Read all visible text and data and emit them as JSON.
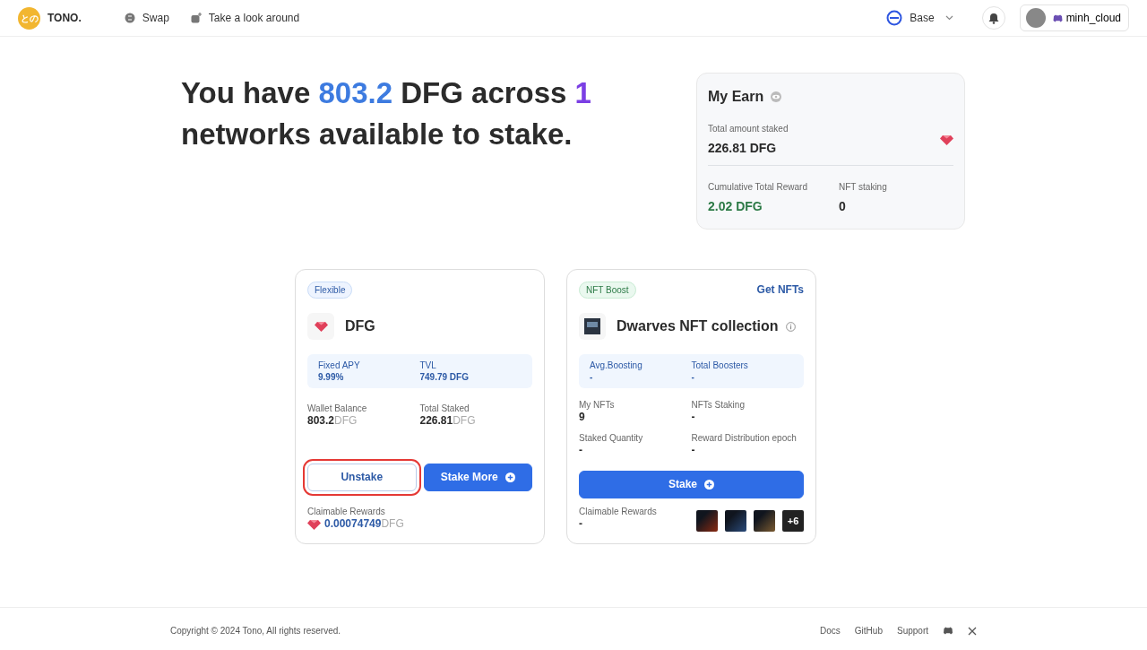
{
  "nav": {
    "logo_glyph": "との",
    "brand": "TONO.",
    "links": [
      {
        "label": "Swap"
      },
      {
        "label": "Take a look around"
      }
    ],
    "network": "Base",
    "user": "minh_cloud"
  },
  "headline": [
    {
      "text": "You have ",
      "color": "#2b2b2b"
    },
    {
      "text": "803.2",
      "color": "#3d7be0"
    },
    {
      "text": " DFG across ",
      "color": "#2b2b2b"
    },
    {
      "text": "1",
      "color": "#7b3fe4"
    },
    {
      "text": " networks available to stake.",
      "color": "#2b2b2b"
    }
  ],
  "my_earn": {
    "title": "My Earn",
    "total_label": "Total amount staked",
    "total_value": "226.81 DFG",
    "reward_label": "Cumulative Total Reward",
    "reward_value": "2.02 DFG",
    "nft_label": "NFT staking",
    "nft_value": "0"
  },
  "flex_card": {
    "badge": "Flexible",
    "title": "DFG",
    "stats": [
      {
        "label": "Fixed APY",
        "value": "9.99%"
      },
      {
        "label": "TVL",
        "value": "749.79 DFG"
      }
    ],
    "balances": [
      {
        "label": "Wallet Balance",
        "value": "803.2",
        "unit": "DFG"
      },
      {
        "label": "Total Staked",
        "value": "226.81",
        "unit": "DFG"
      }
    ],
    "buttons": [
      {
        "label": "Unstake",
        "kind": "outline",
        "highlighted": true
      },
      {
        "label": "Stake More",
        "kind": "primary",
        "highlighted": false
      }
    ],
    "rewards_label": "Claimable Rewards",
    "rewards_value": "0.00074749",
    "rewards_unit": "DFG"
  },
  "nft_card": {
    "badge": "NFT Boost",
    "link": "Get NFTs",
    "title": "Dwarves NFT collection",
    "stats": [
      {
        "label": "Avg.Boosting",
        "value": "-"
      },
      {
        "label": "Total Boosters",
        "value": "-"
      }
    ],
    "fields": [
      {
        "label": "My NFTs",
        "value": "9"
      },
      {
        "label": "NFTs Staking",
        "value": "-"
      },
      {
        "label": "Staked Quantity",
        "value": "-"
      },
      {
        "label": "Reward Distribution epoch",
        "value": "-"
      }
    ],
    "button": "Stake",
    "rewards_label": "Claimable Rewards",
    "rewards_value": "-",
    "more_count": "+6"
  },
  "footer": {
    "copyright": "Copyright © 2024 Tono, All rights reserved.",
    "links": [
      "Docs",
      "GitHub",
      "Support"
    ]
  }
}
